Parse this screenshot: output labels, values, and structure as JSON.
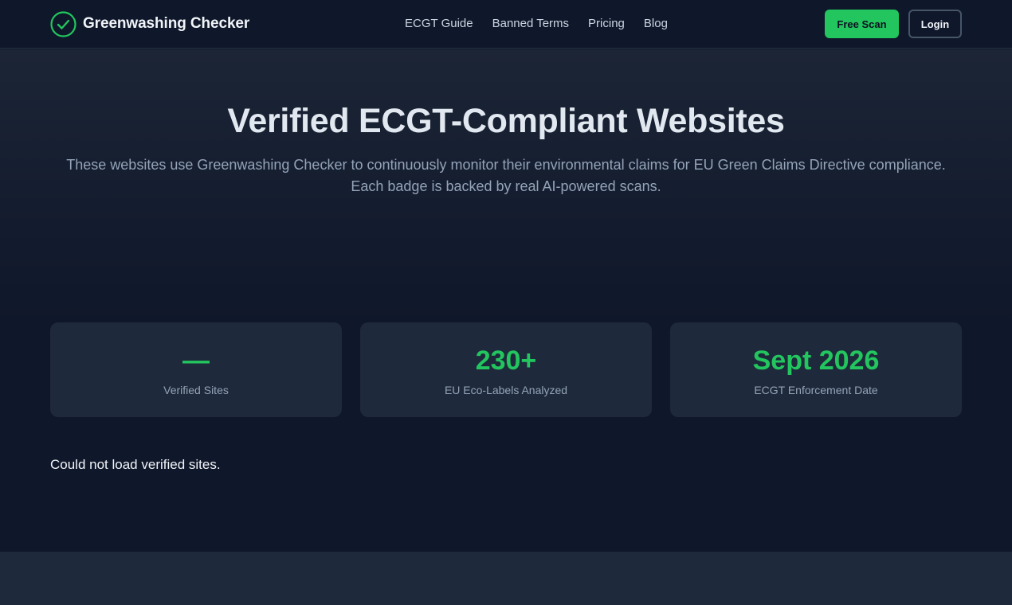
{
  "header": {
    "brand_name": "Greenwashing Checker",
    "brand_icon": "check-circle-icon",
    "nav": [
      {
        "label": "ECGT Guide"
      },
      {
        "label": "Banned Terms"
      },
      {
        "label": "Pricing"
      },
      {
        "label": "Blog"
      }
    ],
    "cta_label": "Free Scan",
    "login_label": "Login"
  },
  "hero": {
    "title": "Verified ECGT-Compliant Websites",
    "subtitle": "These websites use Greenwashing Checker to continuously monitor their environmental claims for EU Green Claims Directive compliance. Each badge is backed by real AI-powered scans."
  },
  "stats": [
    {
      "value": "—",
      "label": "Verified Sites"
    },
    {
      "value": "230+",
      "label": "EU Eco-Labels Analyzed"
    },
    {
      "value": "Sept 2026",
      "label": "ECGT Enforcement Date"
    }
  ],
  "status": {
    "error": "Could not load verified sites."
  },
  "colors": {
    "accent": "#22c55e",
    "background": "#0f172a",
    "card": "#1e293b"
  }
}
